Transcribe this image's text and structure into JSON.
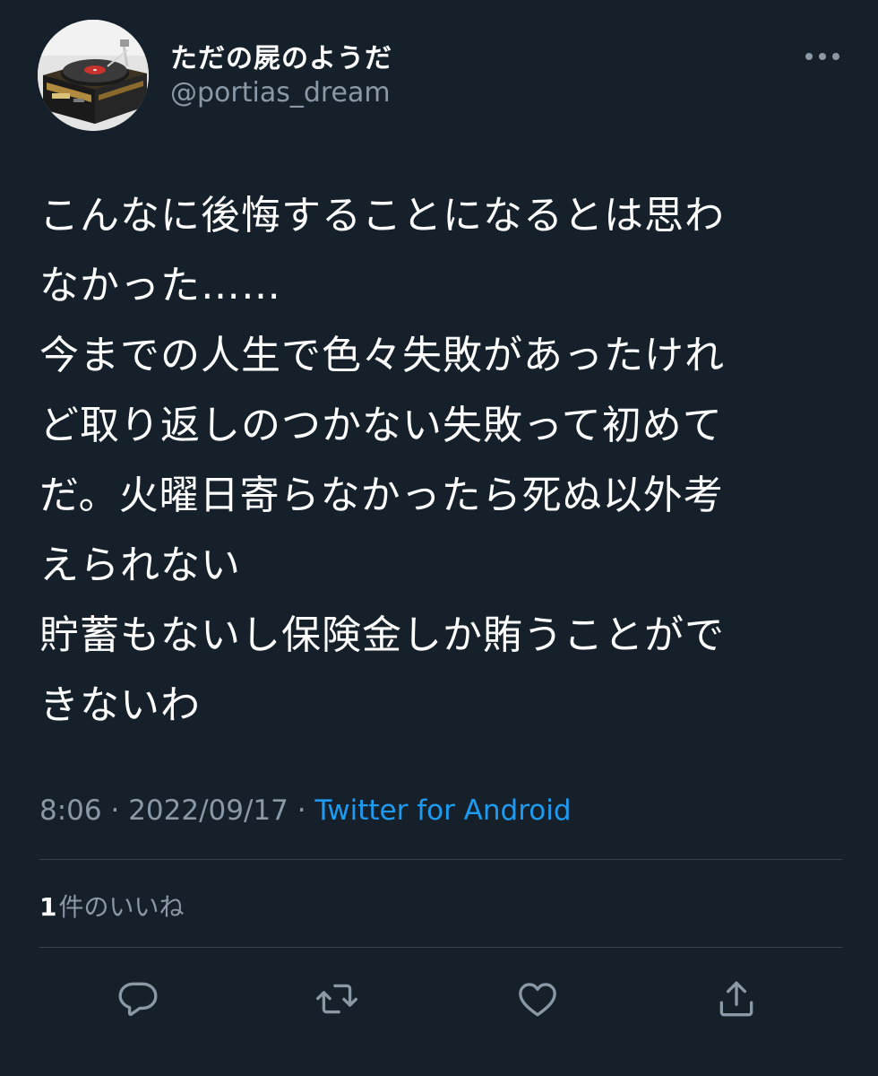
{
  "user": {
    "display_name": "ただの屍のようだ",
    "handle": "@portias_dream"
  },
  "tweet": {
    "lines": [
      "こんなに後悔することになるとは思わ",
      "なかった……",
      "今までの人生で色々失敗があったけれ",
      "ど取り返しのつかない失敗って初めて",
      "だ。火曜日寄らなかったら死ぬ以外考",
      "えられない",
      "貯蓄もないし保険金しか賄うことがで",
      "きないわ"
    ],
    "time": "8:06",
    "separator": " · ",
    "date": "2022/09/17",
    "source": "Twitter for Android"
  },
  "engagement": {
    "like_count": "1",
    "like_label": "件のいいね"
  },
  "actions": [
    {
      "name": "reply-button",
      "icon": "speech-bubble-icon"
    },
    {
      "name": "retweet-button",
      "icon": "retweet-arrows-icon"
    },
    {
      "name": "like-button",
      "icon": "heart-icon"
    },
    {
      "name": "share-button",
      "icon": "share-upload-icon"
    }
  ],
  "colors": {
    "background": "#15202b",
    "text": "#ffffff",
    "secondary_text": "#8b98a5",
    "link": "#1d9bf0",
    "divider": "#38444d"
  }
}
